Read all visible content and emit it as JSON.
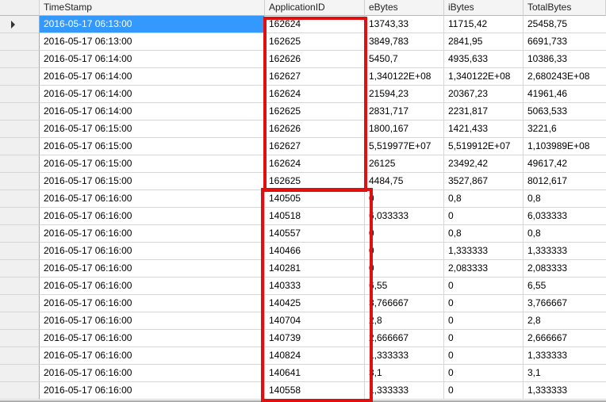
{
  "columns": [
    "TimeStamp",
    "ApplicationID",
    "eBytes",
    "iBytes",
    "TotalBytes"
  ],
  "rows": [
    [
      "2016-05-17 06:13:00",
      "162624",
      "13743,33",
      "11715,42",
      "25458,75"
    ],
    [
      "2016-05-17 06:13:00",
      "162625",
      "3849,783",
      "2841,95",
      "6691,733"
    ],
    [
      "2016-05-17 06:14:00",
      "162626",
      "5450,7",
      "4935,633",
      "10386,33"
    ],
    [
      "2016-05-17 06:14:00",
      "162627",
      "1,340122E+08",
      "1,340122E+08",
      "2,680243E+08"
    ],
    [
      "2016-05-17 06:14:00",
      "162624",
      "21594,23",
      "20367,23",
      "41961,46"
    ],
    [
      "2016-05-17 06:14:00",
      "162625",
      "2831,717",
      "2231,817",
      "5063,533"
    ],
    [
      "2016-05-17 06:15:00",
      "162626",
      "1800,167",
      "1421,433",
      "3221,6"
    ],
    [
      "2016-05-17 06:15:00",
      "162627",
      "5,519977E+07",
      "5,519912E+07",
      "1,103989E+08"
    ],
    [
      "2016-05-17 06:15:00",
      "162624",
      "26125",
      "23492,42",
      "49617,42"
    ],
    [
      "2016-05-17 06:15:00",
      "162625",
      "4484,75",
      "3527,867",
      "8012,617"
    ],
    [
      "2016-05-17 06:16:00",
      "140505",
      "0",
      "0,8",
      "0,8"
    ],
    [
      "2016-05-17 06:16:00",
      "140518",
      "6,033333",
      "0",
      "6,033333"
    ],
    [
      "2016-05-17 06:16:00",
      "140557",
      "0",
      "0,8",
      "0,8"
    ],
    [
      "2016-05-17 06:16:00",
      "140466",
      "0",
      "1,333333",
      "1,333333"
    ],
    [
      "2016-05-17 06:16:00",
      "140281",
      "0",
      "2,083333",
      "2,083333"
    ],
    [
      "2016-05-17 06:16:00",
      "140333",
      "6,55",
      "0",
      "6,55"
    ],
    [
      "2016-05-17 06:16:00",
      "140425",
      "3,766667",
      "0",
      "3,766667"
    ],
    [
      "2016-05-17 06:16:00",
      "140704",
      "2,8",
      "0",
      "2,8"
    ],
    [
      "2016-05-17 06:16:00",
      "140739",
      "2,666667",
      "0",
      "2,666667"
    ],
    [
      "2016-05-17 06:16:00",
      "140824",
      "1,333333",
      "0",
      "1,333333"
    ],
    [
      "2016-05-17 06:16:00",
      "140641",
      "3,1",
      "0",
      "3,1"
    ],
    [
      "2016-05-17 06:16:00",
      "140558",
      "1,333333",
      "0",
      "1,333333"
    ]
  ],
  "selected_row": 0,
  "colors": {
    "selection": "#3399ff",
    "highlight_border": "#e01010",
    "grid_line": "#d6d6d6",
    "header_bg": "#f4f4f4"
  },
  "icons": [
    "current-row-arrow-icon"
  ]
}
